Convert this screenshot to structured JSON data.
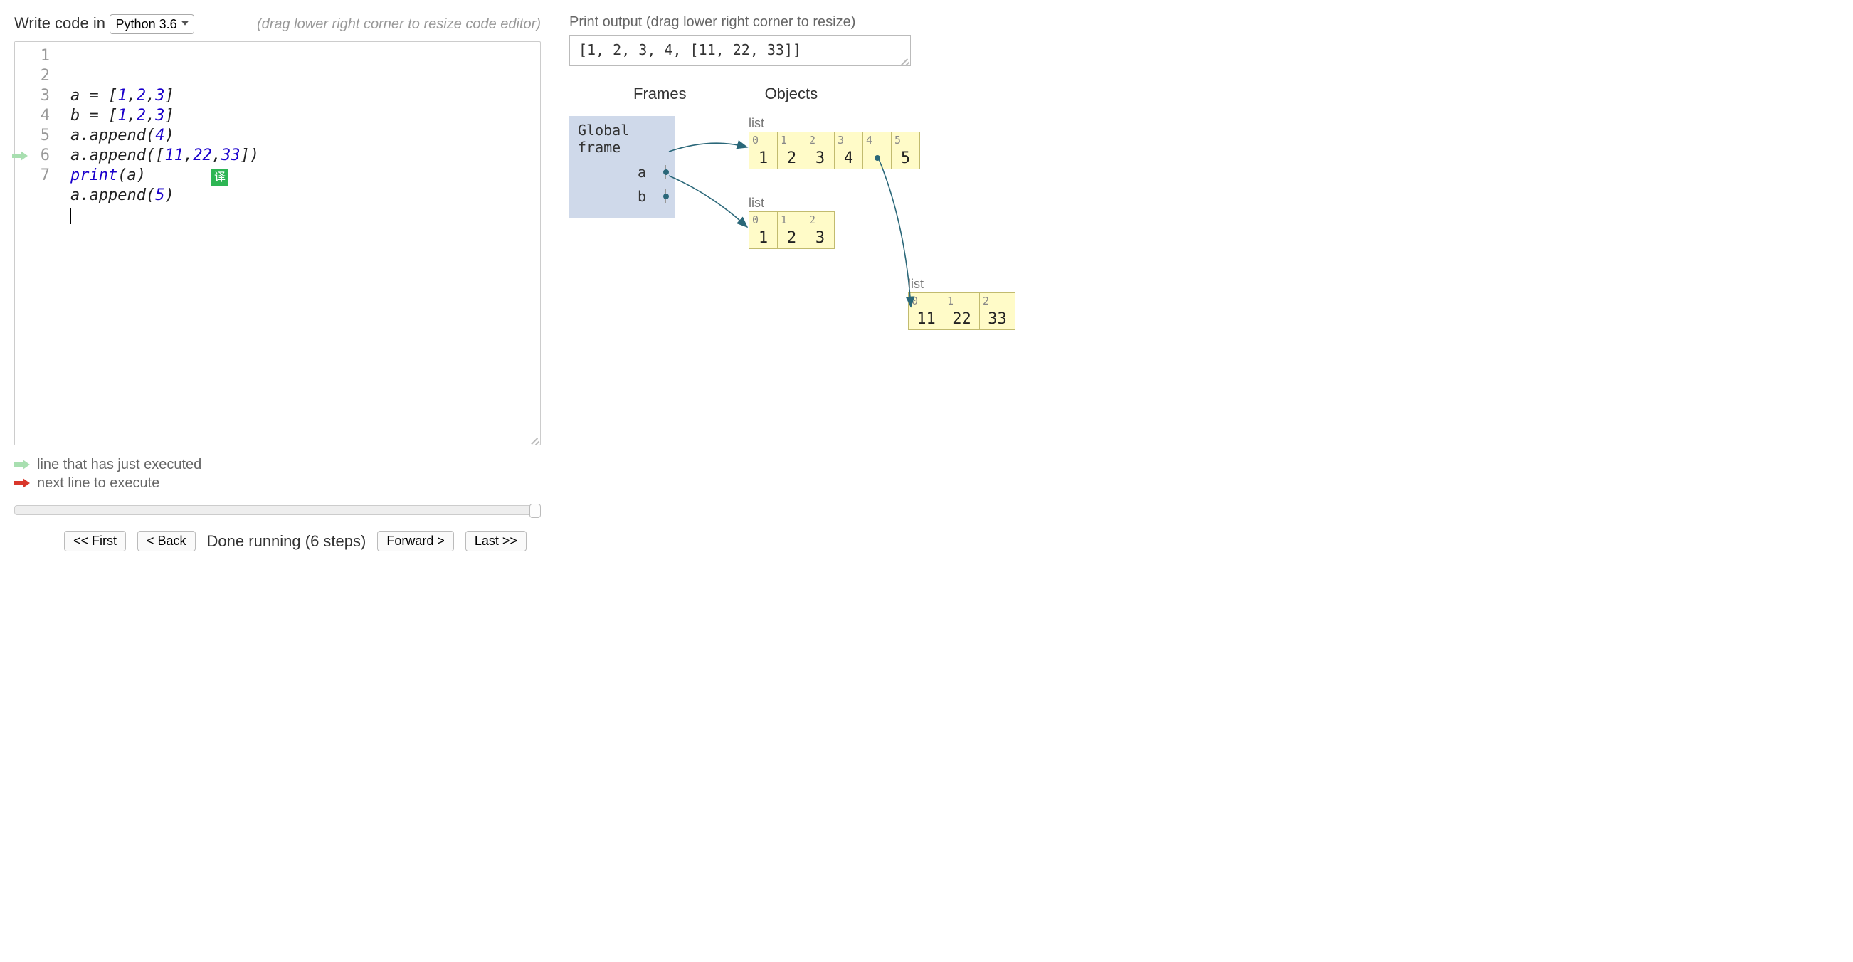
{
  "header": {
    "write_code_label": "Write code in",
    "language": "Python 3.6",
    "resize_hint": "(drag lower right corner to resize code editor)"
  },
  "editor": {
    "executed_line": 6,
    "lines": [
      {
        "n": 1,
        "tokens": [
          [
            "id",
            "a"
          ],
          [
            "op",
            " = "
          ],
          [
            "p",
            "["
          ],
          [
            "num",
            "1"
          ],
          [
            "p",
            ","
          ],
          [
            "num",
            "2"
          ],
          [
            "p",
            ","
          ],
          [
            "num",
            "3"
          ],
          [
            "p",
            "]"
          ]
        ]
      },
      {
        "n": 2,
        "tokens": [
          [
            "id",
            "b"
          ],
          [
            "op",
            " = "
          ],
          [
            "p",
            "["
          ],
          [
            "num",
            "1"
          ],
          [
            "p",
            ","
          ],
          [
            "num",
            "2"
          ],
          [
            "p",
            ","
          ],
          [
            "num",
            "3"
          ],
          [
            "p",
            "]"
          ]
        ]
      },
      {
        "n": 3,
        "tokens": [
          [
            "id",
            "a"
          ],
          [
            "p",
            "."
          ],
          [
            "id",
            "append"
          ],
          [
            "p",
            "("
          ],
          [
            "num",
            "4"
          ],
          [
            "p",
            ")"
          ]
        ]
      },
      {
        "n": 4,
        "tokens": [
          [
            "id",
            "a"
          ],
          [
            "p",
            "."
          ],
          [
            "id",
            "append"
          ],
          [
            "p",
            "(["
          ],
          [
            "num",
            "11"
          ],
          [
            "p",
            ","
          ],
          [
            "num",
            "22"
          ],
          [
            "p",
            ","
          ],
          [
            "num",
            "33"
          ],
          [
            "p",
            "])"
          ]
        ]
      },
      {
        "n": 5,
        "tokens": [
          [
            "fn",
            "print"
          ],
          [
            "p",
            "("
          ],
          [
            "id",
            "a"
          ],
          [
            "p",
            ")"
          ]
        ]
      },
      {
        "n": 6,
        "tokens": [
          [
            "id",
            "a"
          ],
          [
            "p",
            "."
          ],
          [
            "id",
            "append"
          ],
          [
            "p",
            "("
          ],
          [
            "num",
            "5"
          ],
          [
            "p",
            ")"
          ]
        ]
      },
      {
        "n": 7,
        "tokens": []
      }
    ],
    "translate_badge": "译"
  },
  "legend": {
    "executed": "line that has just executed",
    "next": "next line to execute"
  },
  "controls": {
    "first": "<< First",
    "back": "< Back",
    "status": "Done running (6 steps)",
    "forward": "Forward >",
    "last": "Last >>"
  },
  "output": {
    "label": "Print output (drag lower right corner to resize)",
    "text": "[1, 2, 3, 4, [11, 22, 33]]"
  },
  "vis": {
    "frames_header": "Frames",
    "objects_header": "Objects",
    "global_frame_label": "Global frame",
    "vars": [
      "a",
      "b"
    ],
    "list1": {
      "label": "list",
      "idx": [
        "0",
        "1",
        "2",
        "3",
        "4",
        "5"
      ],
      "val": [
        "1",
        "2",
        "3",
        "4",
        "",
        "5"
      ],
      "ref_cell": 4
    },
    "list2": {
      "label": "list",
      "idx": [
        "0",
        "1",
        "2"
      ],
      "val": [
        "1",
        "2",
        "3"
      ]
    },
    "list3": {
      "label": "list",
      "idx": [
        "0",
        "1",
        "2"
      ],
      "val": [
        "11",
        "22",
        "33"
      ]
    }
  }
}
